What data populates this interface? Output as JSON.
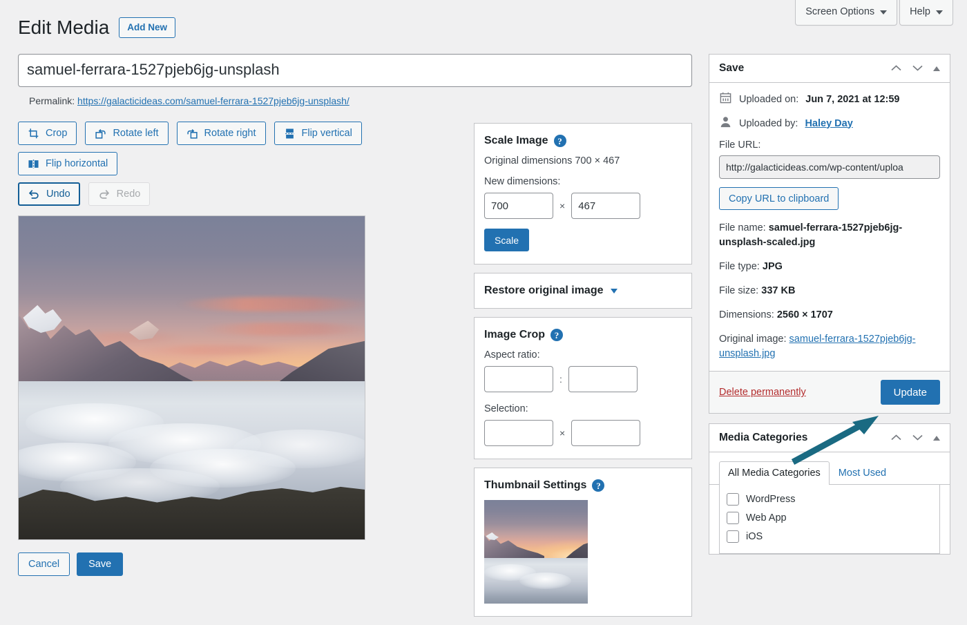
{
  "screen_meta": {
    "screen_options": "Screen Options",
    "help": "Help"
  },
  "header": {
    "title": "Edit Media",
    "add_new": "Add New"
  },
  "title_field": {
    "value": "samuel-ferrara-1527pjeb6jg-unsplash"
  },
  "permalink": {
    "label": "Permalink:",
    "url": "https://galacticideas.com/samuel-ferrara-1527pjeb6jg-unsplash/"
  },
  "editor_tools": {
    "crop": "Crop",
    "rotate_left": "Rotate left",
    "rotate_right": "Rotate right",
    "flip_vertical": "Flip vertical",
    "flip_horizontal": "Flip horizontal",
    "undo": "Undo",
    "redo": "Redo"
  },
  "editor_actions": {
    "cancel": "Cancel",
    "save": "Save"
  },
  "scale_image": {
    "title": "Scale Image",
    "help": "?",
    "original_dimensions": "Original dimensions 700 × 467",
    "new_dimensions_label": "New dimensions:",
    "width": "700",
    "height": "467",
    "separator": "×",
    "scale_button": "Scale"
  },
  "restore": {
    "title": "Restore original image"
  },
  "image_crop": {
    "title": "Image Crop",
    "help": "?",
    "aspect_ratio_label": "Aspect ratio:",
    "aspect_w": "",
    "aspect_h": "",
    "aspect_separator": ":",
    "selection_label": "Selection:",
    "selection_w": "",
    "selection_h": "",
    "selection_separator": "×"
  },
  "thumbnail_settings": {
    "title": "Thumbnail Settings",
    "help": "?"
  },
  "save_box": {
    "title": "Save",
    "uploaded_on_label": "Uploaded on:",
    "uploaded_on_value": "Jun 7, 2021 at 12:59",
    "uploaded_by_label": "Uploaded by:",
    "uploaded_by_value": "Haley Day",
    "file_url_label": "File URL:",
    "file_url_value": "http://galacticideas.com/wp-content/uploa",
    "copy_url_button": "Copy URL to clipboard",
    "file_name_label": "File name:",
    "file_name_value": "samuel-ferrara-1527pjeb6jg-unsplash-scaled.jpg",
    "file_type_label": "File type:",
    "file_type_value": "JPG",
    "file_size_label": "File size:",
    "file_size_value": "337 KB",
    "dimensions_label": "Dimensions:",
    "dimensions_value": "2560 × 1707",
    "original_image_label": "Original image:",
    "original_image_value": "samuel-ferrara-1527pjeb6jg-unsplash.jpg",
    "delete_permanently": "Delete permanently",
    "update_button": "Update"
  },
  "media_categories": {
    "title": "Media Categories",
    "tabs": [
      {
        "label": "All Media Categories",
        "active": true
      },
      {
        "label": "Most Used",
        "active": false
      }
    ],
    "items": [
      {
        "label": "WordPress",
        "checked": false
      },
      {
        "label": "Web App",
        "checked": false
      },
      {
        "label": "iOS",
        "checked": false
      }
    ]
  },
  "colors": {
    "accent": "#2271b1",
    "danger": "#b32d2e",
    "annotation": "#1a6a82",
    "page_bg": "#f0f0f1",
    "border": "#c3c4c7"
  }
}
